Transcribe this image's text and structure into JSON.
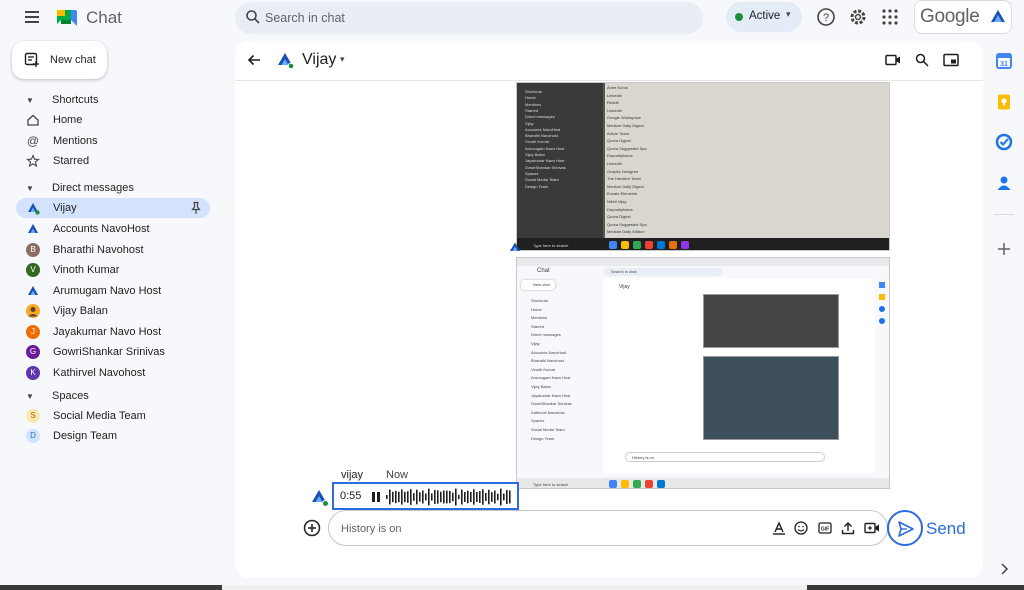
{
  "app": {
    "title": "Chat"
  },
  "search": {
    "placeholder": "Search in chat"
  },
  "status": {
    "label": "Active",
    "color": "#1e8e3e"
  },
  "google": {
    "wordmark": "Google"
  },
  "sidebar": {
    "new_chat_label": "New chat",
    "shortcuts_header": "Shortcuts",
    "shortcuts": [
      {
        "label": "Home",
        "icon": "home-icon"
      },
      {
        "label": "Mentions",
        "icon": "at-icon"
      },
      {
        "label": "Starred",
        "icon": "star-icon"
      }
    ],
    "dm_header": "Direct messages",
    "direct_messages": [
      {
        "label": "Vijay",
        "avatar": "navohost-logo",
        "active": true
      },
      {
        "label": "Accounts NavoHost",
        "avatar": "navohost-logo"
      },
      {
        "label": "Bharathi Navohost",
        "avatar": "B",
        "color": "#8d6e63"
      },
      {
        "label": "Vinoth Kumar",
        "avatar": "V",
        "color": "#33691e"
      },
      {
        "label": "Arumugam Navo Host",
        "avatar": "navohost-logo"
      },
      {
        "label": "Vijay Balan",
        "avatar": "photo",
        "color": "#f9a825"
      },
      {
        "label": "Jayakumar Navo Host",
        "avatar": "J",
        "color": "#ef6c00"
      },
      {
        "label": "GowriShankar Srinivas",
        "avatar": "G",
        "color": "#6a1b9a"
      },
      {
        "label": "Kathirvel Navohost",
        "avatar": "K",
        "color": "#5e35b1"
      }
    ],
    "spaces_header": "Spaces",
    "spaces": [
      {
        "label": "Social Media Team",
        "avatar": "S",
        "color": "#fce8b2",
        "text_color": "#b06000"
      },
      {
        "label": "Design Team",
        "avatar": "D",
        "color": "#d2e3fc",
        "text_color": "#1a73e8"
      }
    ]
  },
  "conversation": {
    "name": "Vijay",
    "message": {
      "sender": "vijay",
      "time": "Now",
      "voice_duration": "0:55"
    },
    "composer_placeholder": "History is on",
    "send_label": "Send"
  },
  "screenshot1": {
    "left_labels": [
      "Shortcuts",
      "Home",
      "Mentions",
      "Starred",
      "Direct messages",
      "Vijay",
      "Accounts NavoHost",
      "Bharathi Navohost",
      "Vinoth Kumar",
      "Arumugam Navo Host",
      "Vijay Balan",
      "Jayakumar Navo Host",
      "GowriShankar Srinivas",
      "Spaces",
      "Social Media Team",
      "Design Team"
    ],
    "rows": [
      "Anne Kuros",
      "LinkedIn",
      "Reddit",
      "LinkedIn",
      "Google Workspace",
      "Medium Daily Digest",
      "Article Team",
      "Quora Digest",
      "Quora Suggested Spa",
      "Depositphotos",
      "LinkedIn",
      "Graphic Designer",
      "The Hardtext Team",
      "Medium Daily Digest",
      "Envato Elements",
      "Nikhil Vijay",
      "Depositphotos",
      "Quora Digest",
      "Quora Suggested Spa",
      "Medium Daily Edition"
    ],
    "taskbar_search": "Type here to search"
  },
  "screenshot2": {
    "app_title": "Chat",
    "search_placeholder": "Search in chat",
    "contact": "Vijay",
    "new_chat": "New chat",
    "composer": "History is on",
    "side_labels": [
      "Shortcuts",
      "Home",
      "Mentions",
      "Starred",
      "Direct messages",
      "Vijay",
      "Accounts NavoHost",
      "Bharathi Navohost",
      "Vinoth Kumar",
      "Arumugam Navo Host",
      "Vijay Balan",
      "Jayakumar Navo Host",
      "GowriShankar Srinivas",
      "Kathirvel Navohost",
      "Spaces",
      "Social Media Team",
      "Design Team"
    ],
    "taskbar_search": "Type here to search"
  },
  "colors": {
    "accent": "#2d6cdf",
    "active_row": "#d3e3fd",
    "background": "#f6f8fc"
  }
}
